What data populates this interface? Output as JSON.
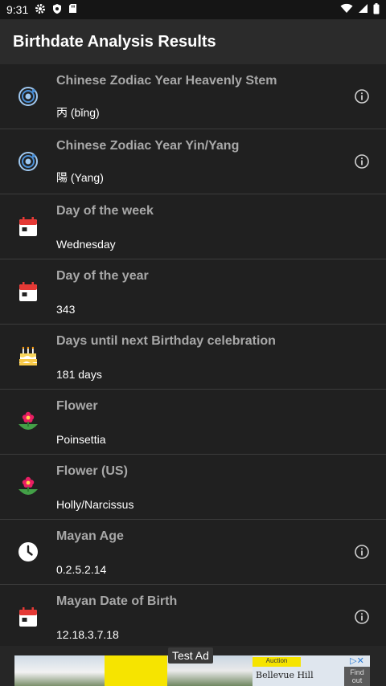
{
  "status_bar": {
    "time": "9:31"
  },
  "app_bar": {
    "title": "Birthdate Analysis Results"
  },
  "rows": [
    {
      "title": "Chinese Zodiac Year Heavenly Stem",
      "value": "丙 (bǐng)",
      "icon": "orbit-icon",
      "info": true
    },
    {
      "title": "Chinese Zodiac Year Yin/Yang",
      "value": "陽 (Yang)",
      "icon": "orbit-icon",
      "info": true
    },
    {
      "title": "Day of the week",
      "value": "Wednesday",
      "icon": "calendar-icon",
      "info": false
    },
    {
      "title": "Day of the year",
      "value": "343",
      "icon": "calendar-icon",
      "info": false
    },
    {
      "title": "Days until next Birthday celebration",
      "value": "181 days",
      "icon": "birthday-cake-icon",
      "info": false
    },
    {
      "title": "Flower",
      "value": "Poinsettia",
      "icon": "flower-icon",
      "info": false
    },
    {
      "title": "Flower (US)",
      "value": "Holly/Narcissus",
      "icon": "flower-icon",
      "info": false
    },
    {
      "title": "Mayan Age",
      "value": "0.2.5.2.14",
      "icon": "clock-icon",
      "info": true
    },
    {
      "title": "Mayan Date of Birth",
      "value": "12.18.3.7.18",
      "icon": "calendar-icon",
      "info": true
    }
  ],
  "ad": {
    "label": "Test Ad",
    "tag": "Auction",
    "brand": "Bellevue Hill",
    "cta": "Find out"
  },
  "colors": {
    "background": "#202020",
    "title_text": "#a8a8a8",
    "value_text": "#ffffff"
  }
}
